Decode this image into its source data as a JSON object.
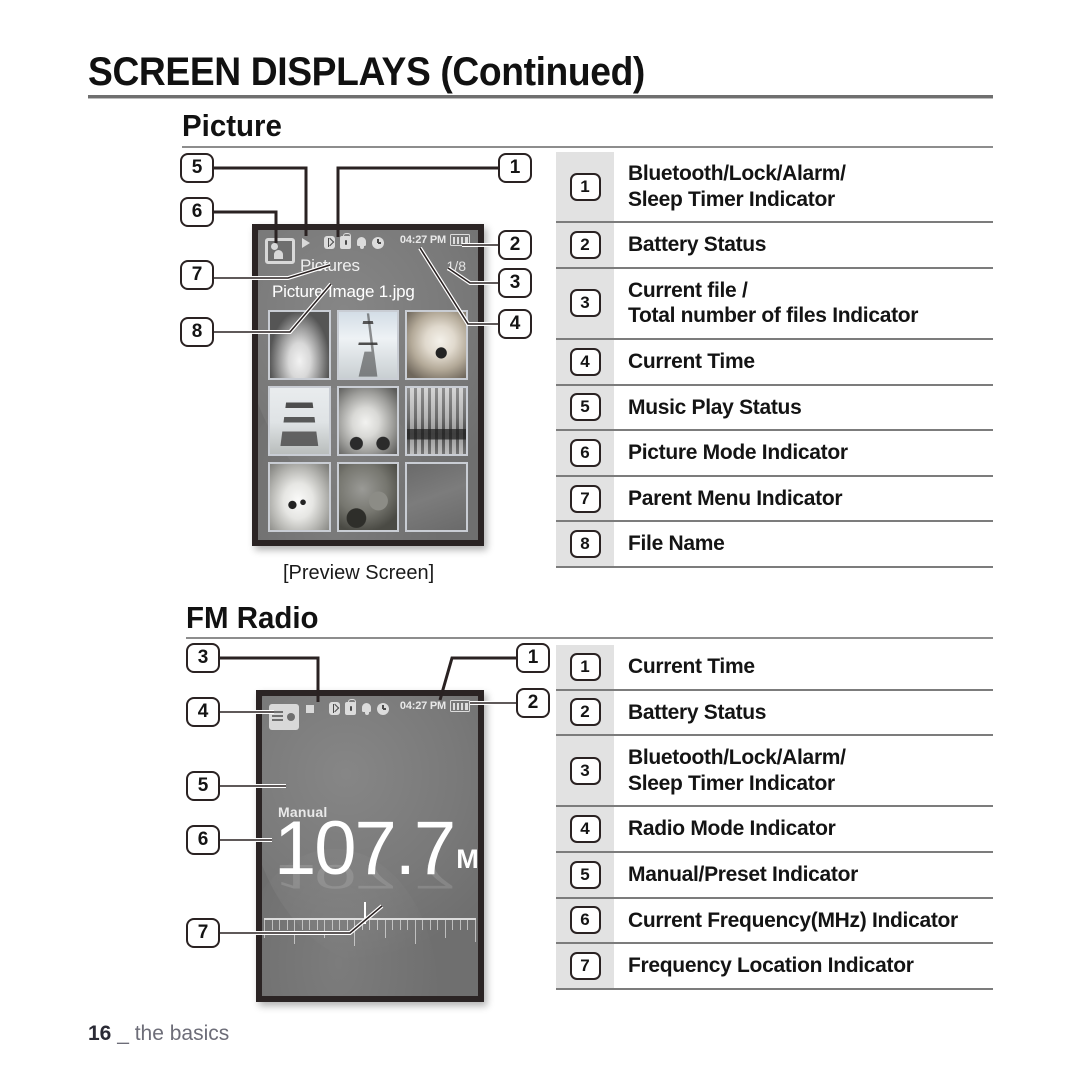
{
  "document": {
    "title": "SCREEN DISPLAYS (Continued)",
    "footer_page": "16",
    "footer_sep": " _ ",
    "footer_section": "the basics"
  },
  "sections": [
    {
      "heading": "Picture",
      "caption": "[Preview Screen]"
    },
    {
      "heading": "FM Radio",
      "caption": ""
    }
  ],
  "picture_screen": {
    "mode_icon": "picture-mode-icon",
    "menu_title": "Pictures",
    "play_status_icon": "play-icon",
    "status_icons": [
      "bluetooth-icon",
      "lock-icon",
      "alarm-bell-icon",
      "sleep-timer-clock-icon"
    ],
    "time": "04:27 PM",
    "battery_icon": "battery-full-icon",
    "battery_bars": 4,
    "file_count": "1/8",
    "file_name": "Picture Image 1.jpg",
    "thumbnails": [
      "cat-photo",
      "eiffel-tower-photo",
      "dog-photo",
      "pagoda-photo",
      "vintage-car-photo",
      "storefront-photo",
      "seal-photo",
      "macaron-photo",
      "empty-slot"
    ]
  },
  "fm_screen": {
    "mode_icon": "radio-mode-icon",
    "play_status_icon": "stop-icon",
    "status_icons": [
      "bluetooth-icon",
      "lock-icon",
      "alarm-bell-icon",
      "sleep-timer-clock-icon"
    ],
    "time": "04:27 PM",
    "battery_icon": "battery-full-icon",
    "battery_bars": 4,
    "tuning_mode": "Manual",
    "frequency": "107.7",
    "frequency_unit": "MHz"
  },
  "picture_callouts": [
    {
      "n": "5"
    },
    {
      "n": "6"
    },
    {
      "n": "7"
    },
    {
      "n": "8"
    },
    {
      "n": "1"
    },
    {
      "n": "2"
    },
    {
      "n": "3"
    },
    {
      "n": "4"
    }
  ],
  "fm_callouts": [
    {
      "n": "3"
    },
    {
      "n": "4"
    },
    {
      "n": "5"
    },
    {
      "n": "6"
    },
    {
      "n": "7"
    },
    {
      "n": "1"
    },
    {
      "n": "2"
    }
  ],
  "picture_legend": [
    {
      "n": "1",
      "lines": [
        "Bluetooth/Lock/Alarm/",
        "Sleep Timer Indicator"
      ]
    },
    {
      "n": "2",
      "lines": [
        "Battery Status"
      ]
    },
    {
      "n": "3",
      "lines": [
        "Current file /",
        "Total number of files Indicator"
      ]
    },
    {
      "n": "4",
      "lines": [
        "Current Time"
      ]
    },
    {
      "n": "5",
      "lines": [
        "Music Play Status"
      ]
    },
    {
      "n": "6",
      "lines": [
        "Picture Mode Indicator"
      ]
    },
    {
      "n": "7",
      "lines": [
        "Parent Menu Indicator"
      ]
    },
    {
      "n": "8",
      "lines": [
        "File Name"
      ]
    }
  ],
  "fm_legend": [
    {
      "n": "1",
      "lines": [
        "Current Time"
      ]
    },
    {
      "n": "2",
      "lines": [
        "Battery Status"
      ]
    },
    {
      "n": "3",
      "lines": [
        "Bluetooth/Lock/Alarm/",
        "Sleep Timer Indicator"
      ]
    },
    {
      "n": "4",
      "lines": [
        "Radio Mode Indicator"
      ]
    },
    {
      "n": "5",
      "lines": [
        "Manual/Preset Indicator"
      ]
    },
    {
      "n": "6",
      "lines": [
        "Current Frequency(MHz) Indicator"
      ]
    },
    {
      "n": "7",
      "lines": [
        "Frequency Location Indicator"
      ]
    }
  ],
  "colors": {
    "screen_bg": "#6f6f6f",
    "bezel": "#2b2424",
    "legend_numcol": "#e2e2e2",
    "rule": "#7c7c7c"
  }
}
